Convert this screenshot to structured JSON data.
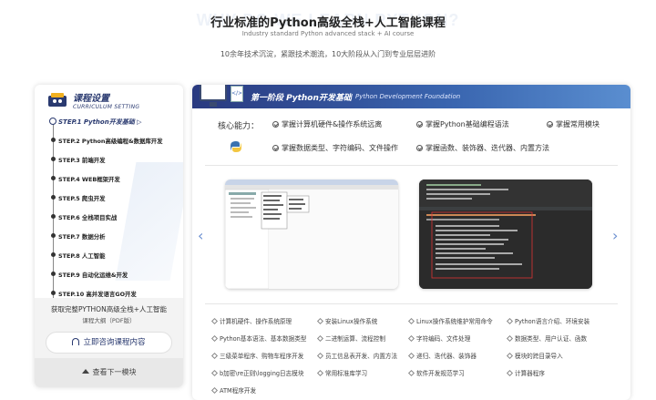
{
  "header": {
    "bg_text": "WHY DO WE LEARN PYTHON?",
    "title": "行业标准的Python高级全栈+人工智能课程",
    "subtitle": "Industry standard Python advanced stack + AI course",
    "desc": "10余年技术沉淀，紧跟技术潮流，10大阶段从入门到专业层层进阶"
  },
  "sidebar": {
    "title": "课程设置",
    "subtitle": "CURRICULUM SETTING",
    "steps": [
      {
        "label": "STEP.1  Python开发基础  ▷"
      },
      {
        "label": "STEP.2 Python高级编程&数据库开发"
      },
      {
        "label": "STEP.3  前端开发"
      },
      {
        "label": "STEP.4 WEB框架开发"
      },
      {
        "label": "STEP.5  爬虫开发"
      },
      {
        "label": "STEP.6  全栈项目实战"
      },
      {
        "label": "STEP.7  数据分析"
      },
      {
        "label": "STEP.8  人工智能"
      },
      {
        "label": "STEP.9  自动化运维&开发"
      },
      {
        "label": "STEP.10  高并发语言GO开发"
      }
    ],
    "footer_title": "获取完整PYTHON高级全栈+人工智能",
    "footer_sub": "课程大纲（PDF版）",
    "consult_label": "立即咨询课程内容",
    "next_label": "查看下一模块"
  },
  "main": {
    "stage_title": "第一阶段  Python开发基础",
    "stage_en": "Python Development Foundation",
    "doc_icon_text": "</>",
    "core_label": "核心能力：",
    "skills": [
      "掌握计算机硬件&操作系统远离",
      "掌握Python基础编程语法",
      "掌握常用模块",
      "掌握数据类型、字符编码、文件操作",
      "掌握函数、装饰器、迭代器、内置方法"
    ],
    "topics": [
      "计算机硬件、操作系统原理",
      "安装Linux操作系统",
      "Linux操作系统维护常用命令",
      "Python语言介绍、环境安装",
      "Python基本语法、基本数据类型",
      "二进制运算、流程控制",
      "字符编码、文件处理",
      "数据类型、用户认证、函数",
      "三级菜单程序、购物车程序开发",
      "员工信息表开发、内置方法",
      "递归、迭代器、装饰器",
      "模块的跨目录导入",
      "b加密\\re正则\\logging日志模块",
      "常用标准库学习",
      "软件开发规范学习",
      "计算器程序",
      "ATM程序开发"
    ],
    "arrow_left": "‹",
    "arrow_right": "›"
  },
  "colors": {
    "brand_dark": "#2a3a70",
    "banner_start": "#2a3a80",
    "banner_end": "#5a8ed0",
    "arrow": "#6b8fd0"
  }
}
